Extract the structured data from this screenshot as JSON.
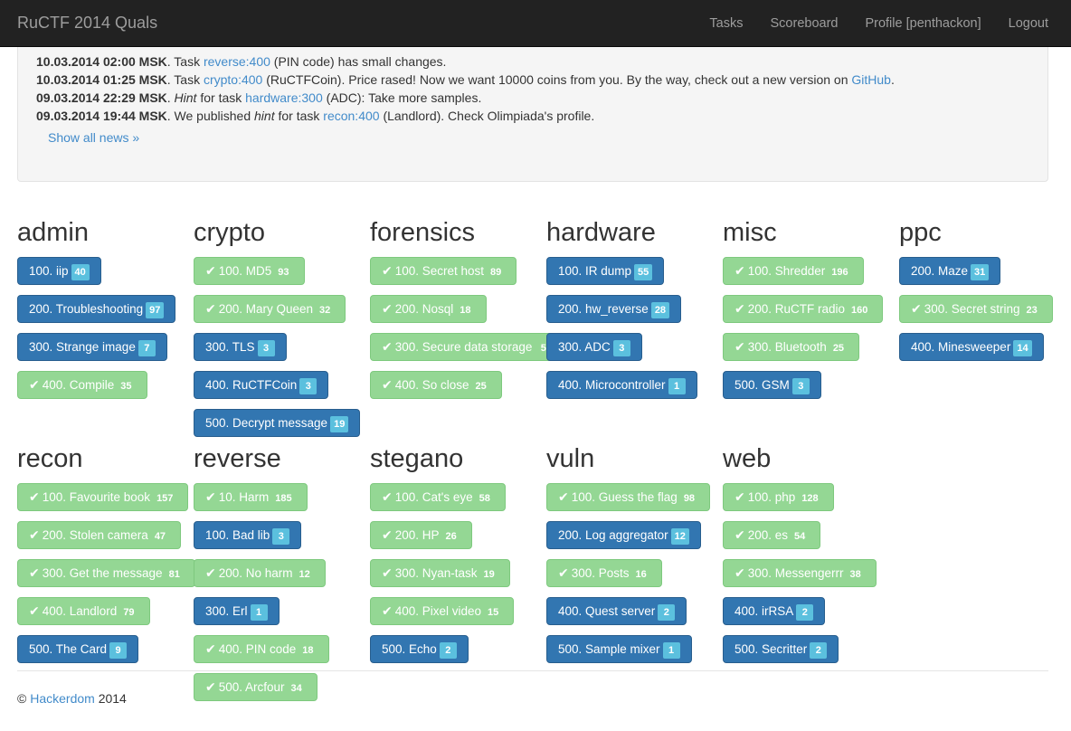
{
  "navbar": {
    "brand": "RuCTF 2014 Quals",
    "links": [
      "Tasks",
      "Scoreboard",
      "Profile [penthackon]",
      "Logout"
    ]
  },
  "news": [
    {
      "time": "10.03.2014 02:00 MSK",
      "parts": [
        {
          "t": ". Task "
        },
        {
          "t": "reverse:400",
          "link": true
        },
        {
          "t": " (PIN code) has small changes."
        }
      ]
    },
    {
      "time": "10.03.2014 01:25 MSK",
      "parts": [
        {
          "t": ". Task "
        },
        {
          "t": "crypto:400",
          "link": true
        },
        {
          "t": " (RuCTFCoin). Price rased! Now we want 10000 coins from you. By the way, check out a new version on "
        },
        {
          "t": "GitHub",
          "link": true
        },
        {
          "t": "."
        }
      ]
    },
    {
      "time": "09.03.2014 22:29 MSK",
      "parts": [
        {
          "t": ". "
        },
        {
          "t": "Hint",
          "italic": true
        },
        {
          "t": " for task "
        },
        {
          "t": "hardware:300",
          "link": true
        },
        {
          "t": " (ADC): Take more samples."
        }
      ]
    },
    {
      "time": "09.03.2014 19:44 MSK",
      "parts": [
        {
          "t": ". We published "
        },
        {
          "t": "hint",
          "italic": true
        },
        {
          "t": " for task "
        },
        {
          "t": "recon:400",
          "link": true
        },
        {
          "t": " (Landlord). Check Olimpiada's profile."
        }
      ]
    }
  ],
  "show_all_news": "Show all news »",
  "categories": [
    {
      "name": "admin",
      "tasks": [
        {
          "label": "100. iip",
          "count": "40",
          "solved": false
        },
        {
          "label": "200. Troubleshooting",
          "count": "97",
          "solved": false
        },
        {
          "label": "300. Strange image",
          "count": "7",
          "solved": false
        },
        {
          "label": "400. Compile",
          "count": "35",
          "solved": true
        }
      ]
    },
    {
      "name": "crypto",
      "tasks": [
        {
          "label": "100. MD5",
          "count": "93",
          "solved": true
        },
        {
          "label": "200. Mary Queen",
          "count": "32",
          "solved": true
        },
        {
          "label": "300. TLS",
          "count": "3",
          "solved": false
        },
        {
          "label": "400. RuCTFCoin",
          "count": "3",
          "solved": false
        },
        {
          "label": "500. Decrypt message",
          "count": "19",
          "solved": false
        }
      ]
    },
    {
      "name": "forensics",
      "tasks": [
        {
          "label": "100. Secret host",
          "count": "89",
          "solved": true
        },
        {
          "label": "200. Nosql",
          "count": "18",
          "solved": true
        },
        {
          "label": "300. Secure data storage",
          "count": "5",
          "solved": true
        },
        {
          "label": "400. So close",
          "count": "25",
          "solved": true
        }
      ]
    },
    {
      "name": "hardware",
      "tasks": [
        {
          "label": "100. IR dump",
          "count": "55",
          "solved": false
        },
        {
          "label": "200. hw_reverse",
          "count": "28",
          "solved": false
        },
        {
          "label": "300. ADC",
          "count": "3",
          "solved": false
        },
        {
          "label": "400. Microcontroller",
          "count": "1",
          "solved": false
        }
      ]
    },
    {
      "name": "misc",
      "tasks": [
        {
          "label": "100. Shredder",
          "count": "196",
          "solved": true
        },
        {
          "label": "200. RuCTF radio",
          "count": "160",
          "solved": true
        },
        {
          "label": "300. Bluetooth",
          "count": "25",
          "solved": true
        },
        {
          "label": "500. GSM",
          "count": "3",
          "solved": false
        }
      ]
    },
    {
      "name": "ppc",
      "tasks": [
        {
          "label": "200. Maze",
          "count": "31",
          "solved": false
        },
        {
          "label": "300. Secret string",
          "count": "23",
          "solved": true
        },
        {
          "label": "400. Minesweeper",
          "count": "14",
          "solved": false
        }
      ]
    },
    {
      "name": "recon",
      "tasks": [
        {
          "label": "100. Favourite book",
          "count": "157",
          "solved": true
        },
        {
          "label": "200. Stolen camera",
          "count": "47",
          "solved": true
        },
        {
          "label": "300. Get the message",
          "count": "81",
          "solved": true
        },
        {
          "label": "400. Landlord",
          "count": "79",
          "solved": true
        },
        {
          "label": "500. The Card",
          "count": "9",
          "solved": false
        }
      ]
    },
    {
      "name": "reverse",
      "tasks": [
        {
          "label": "10. Harm",
          "count": "185",
          "solved": true
        },
        {
          "label": "100. Bad lib",
          "count": "3",
          "solved": false
        },
        {
          "label": "200. No harm",
          "count": "12",
          "solved": true
        },
        {
          "label": "300. Erl",
          "count": "1",
          "solved": false
        },
        {
          "label": "400. PIN code",
          "count": "18",
          "solved": true
        },
        {
          "label": "500. Arcfour",
          "count": "34",
          "solved": true
        }
      ]
    },
    {
      "name": "stegano",
      "tasks": [
        {
          "label": "100. Cat's eye",
          "count": "58",
          "solved": true
        },
        {
          "label": "200. HP",
          "count": "26",
          "solved": true
        },
        {
          "label": "300. Nyan-task",
          "count": "19",
          "solved": true
        },
        {
          "label": "400. Pixel video",
          "count": "15",
          "solved": true
        },
        {
          "label": "500. Echo",
          "count": "2",
          "solved": false
        }
      ]
    },
    {
      "name": "vuln",
      "tasks": [
        {
          "label": "100. Guess the flag",
          "count": "98",
          "solved": true
        },
        {
          "label": "200. Log aggregator",
          "count": "12",
          "solved": false
        },
        {
          "label": "300. Posts",
          "count": "16",
          "solved": true
        },
        {
          "label": "400. Quest server",
          "count": "2",
          "solved": false
        },
        {
          "label": "500. Sample mixer",
          "count": "1",
          "solved": false
        }
      ]
    },
    {
      "name": "web",
      "tasks": [
        {
          "label": "100. php",
          "count": "128",
          "solved": true
        },
        {
          "label": "200. es",
          "count": "54",
          "solved": true
        },
        {
          "label": "300. Messengerrr",
          "count": "38",
          "solved": true
        },
        {
          "label": "400. irRSA",
          "count": "2",
          "solved": false
        },
        {
          "label": "500. Secritter",
          "count": "2",
          "solved": false
        }
      ]
    }
  ],
  "footer": {
    "copyright": "©",
    "link": "Hackerdom",
    "year": "2014"
  },
  "colors": {
    "open": "#3276b1",
    "solved": "#94d794",
    "badge": "#5bc0de",
    "link": "#428bca",
    "navbar": "#222222"
  }
}
